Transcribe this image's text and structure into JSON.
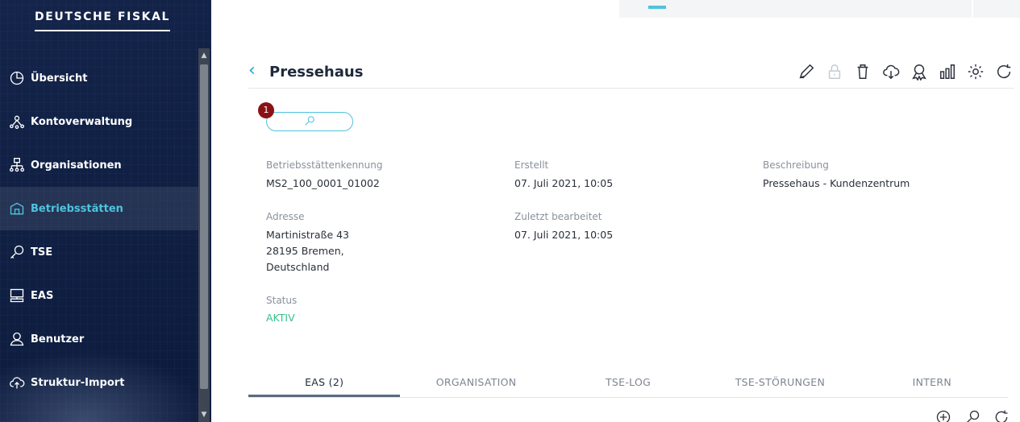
{
  "app": {
    "brand": "DEUTSCHE FISKAL"
  },
  "sidebar": {
    "items": [
      {
        "label": "Übersicht",
        "icon": "clock-pie-icon",
        "active": false
      },
      {
        "label": "Kontoverwaltung",
        "icon": "network-person-icon",
        "active": false
      },
      {
        "label": "Organisationen",
        "icon": "org-chart-icon",
        "active": false
      },
      {
        "label": "Betriebsstätten",
        "icon": "building-icon",
        "active": true
      },
      {
        "label": "TSE",
        "icon": "key-icon",
        "active": false
      },
      {
        "label": "EAS",
        "icon": "monitor-icon",
        "active": false
      },
      {
        "label": "Benutzer",
        "icon": "users-icon",
        "active": false
      },
      {
        "label": "Struktur-Import",
        "icon": "cloud-upload-icon",
        "active": false
      }
    ]
  },
  "header": {
    "back_icon": "chevron-left-icon",
    "title": "Pressehaus",
    "toolbar": [
      "edit-icon",
      "lock-icon",
      "trash-icon",
      "cloud-download-icon",
      "certificate-icon",
      "bar-chart-icon",
      "settings-icon",
      "refresh-icon"
    ]
  },
  "tse_pill": {
    "count": "1",
    "icon": "key-icon"
  },
  "details": {
    "betriebsstaettenkennung": {
      "label": "Betriebsstättenkennung",
      "value": "MS2_100_0001_01002"
    },
    "erstellt": {
      "label": "Erstellt",
      "value": "07. Juli 2021, 10:05"
    },
    "beschreibung": {
      "label": "Beschreibung",
      "value": "Pressehaus - Kundenzentrum"
    },
    "adresse": {
      "label": "Adresse",
      "line1": "Martinistraße 43",
      "line2": "28195 Bremen,",
      "line3": "Deutschland"
    },
    "zuletzt": {
      "label": "Zuletzt bearbeitet",
      "value": "07. Juli 2021, 10:05"
    },
    "status": {
      "label": "Status",
      "value": "AKTIV"
    }
  },
  "tabs": [
    "EAS (2)",
    "ORGANISATION",
    "TSE-LOG",
    "TSE-STÖRUNGEN",
    "INTERN"
  ],
  "active_tab": "EAS (2)",
  "bottom_tools": [
    "add-circle-icon",
    "search-icon",
    "refresh-icon"
  ],
  "colors": {
    "accent": "#4fc3dc",
    "sidebar_bg": "#102044",
    "status_active": "#37c08a",
    "badge": "#8b1214"
  }
}
